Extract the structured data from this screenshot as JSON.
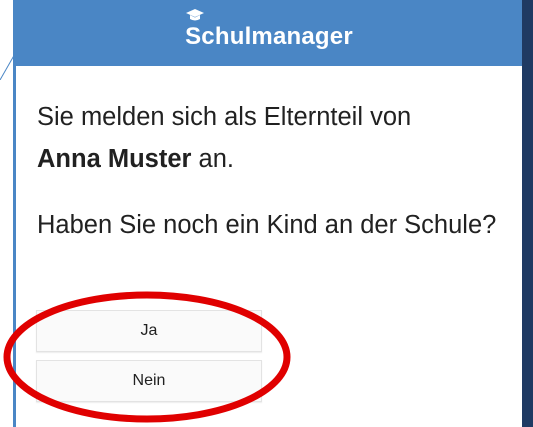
{
  "app": {
    "brand": "Schulmanager"
  },
  "message": {
    "line1_prefix": "Sie melden sich als Elternteil von",
    "child_name": "Anna Muster",
    "line1_suffix": " an.",
    "question": "Haben Sie noch ein Kind an der Schule?"
  },
  "buttons": {
    "yes": "Ja",
    "no": "Nein"
  },
  "colors": {
    "header": "#4a86c5",
    "annotation": "#e00000",
    "right_strip": "#1f3a63"
  },
  "icons": {
    "brand": "graduation-cap-icon"
  }
}
